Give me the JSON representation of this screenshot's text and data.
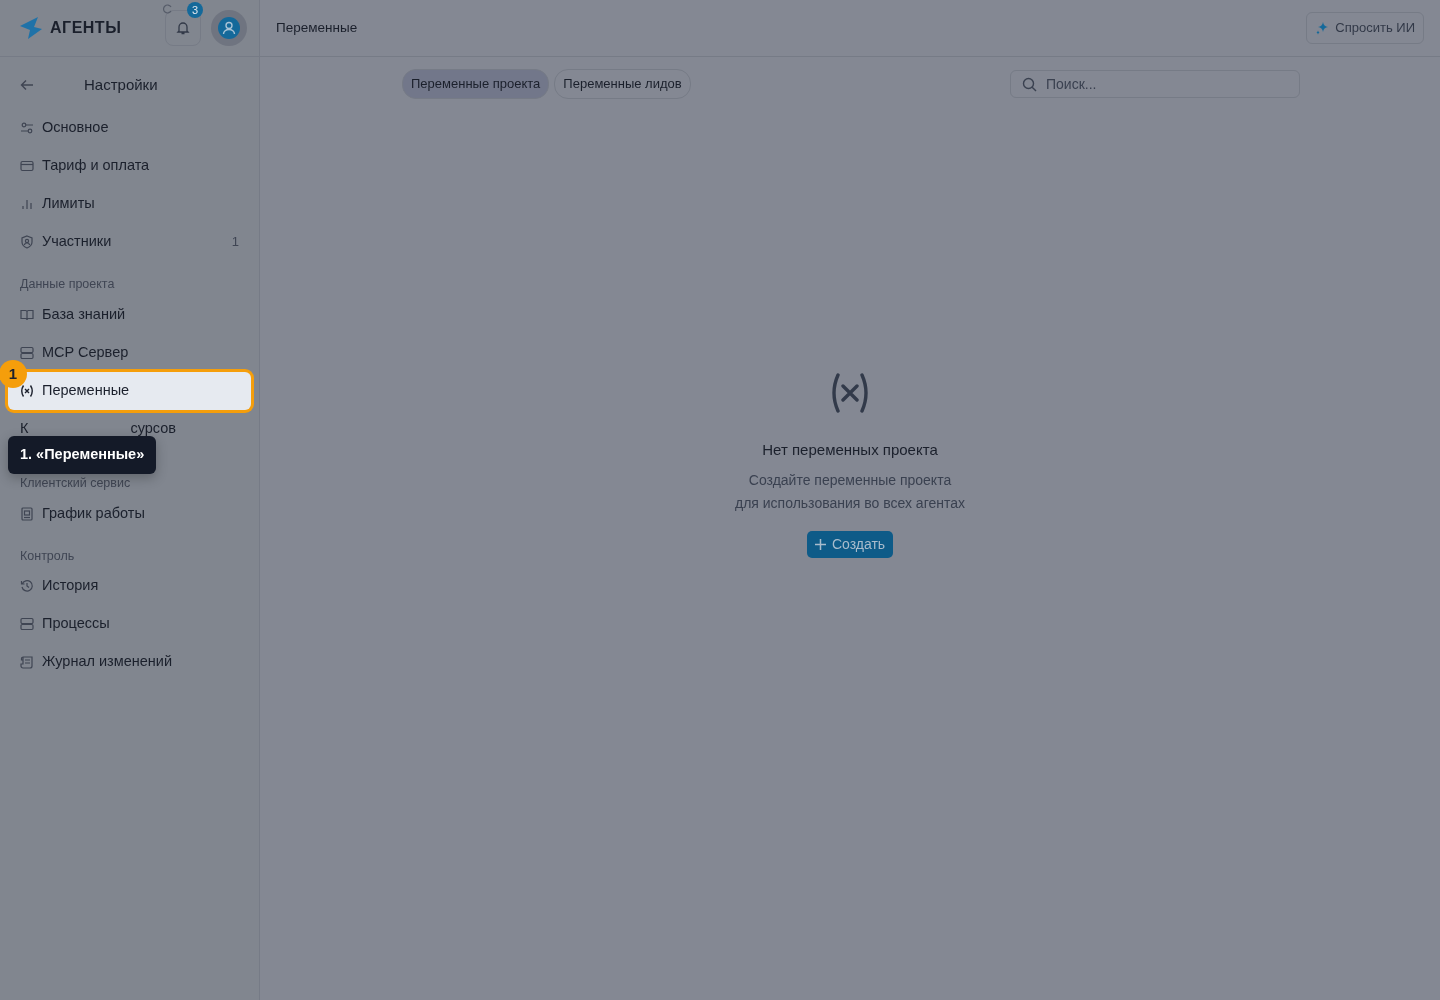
{
  "brand": {
    "name": "АГЕНТЫ"
  },
  "notifications": {
    "count": "3"
  },
  "header": {
    "title": "Переменные",
    "ask_button": "Спросить ИИ"
  },
  "sidebar": {
    "back_title": "Настройки",
    "groups": [
      {
        "items": [
          {
            "label": "Основное",
            "selected": false
          },
          {
            "label": "Тариф и оплата",
            "selected": false
          },
          {
            "label": "Лимиты",
            "selected": false
          },
          {
            "label": "Участники",
            "count": "1",
            "selected": false
          }
        ]
      },
      {
        "heading": "Данные проекта",
        "items": [
          {
            "label": "База знаний",
            "selected": false
          },
          {
            "label": "MCP Сервер",
            "selected": false
          },
          {
            "label": "Переменные",
            "selected": true
          },
          {
            "kind": "covered",
            "label_parts": [
              "К",
              "сурсов"
            ],
            "selected": false
          }
        ]
      },
      {
        "heading": "Клиентский сервис",
        "items": [
          {
            "label": "График работы",
            "selected": false
          }
        ]
      },
      {
        "heading": "Контроль",
        "items": [
          {
            "label": "История",
            "selected": false
          },
          {
            "label": "Процессы",
            "selected": false
          },
          {
            "label": "Журнал изменений",
            "selected": false
          }
        ]
      }
    ]
  },
  "tabs": [
    {
      "label": "Переменные проекта",
      "selected": true
    },
    {
      "label": "Переменные лидов",
      "selected": false
    }
  ],
  "search": {
    "placeholder": "Поиск..."
  },
  "empty_state": {
    "title": "Нет переменных проекта",
    "lines": [
      "Создайте переменные проекта",
      "для использования во всех агентах"
    ],
    "button": "Создать"
  },
  "tour": {
    "step": "1",
    "tooltip": "1. «Переменные»"
  }
}
